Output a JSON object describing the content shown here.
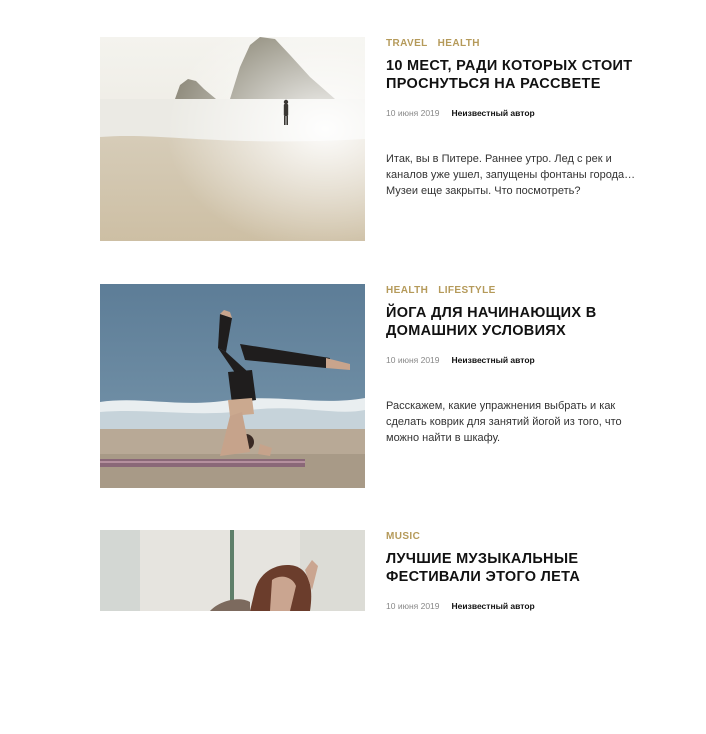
{
  "posts": [
    {
      "categories": [
        "TRAVEL",
        "HEALTH"
      ],
      "title": "10 мест, ради которых стоит проснуться на рассвете",
      "date": "10 июня 2019",
      "author": "Неизвестный автор",
      "excerpt": "Итак, вы в Питере. Раннее утро. Лед с рек и каналов уже ушел, запущены фонтаны города… Музеи еще закрыты. Что посмотреть?"
    },
    {
      "categories": [
        "HEALTH",
        "LIFESTYLE"
      ],
      "title": "Йога для начинающих в домашних условиях",
      "date": "10 июня 2019",
      "author": "Неизвестный автор",
      "excerpt": "Расскажем, какие упражнения выбрать и как сделать коврик для занятий йогой из того, что можно найти в шкафу."
    },
    {
      "categories": [
        "MUSIC"
      ],
      "title": "Лучшие музыкальные фестивали этого лета",
      "date": "10 июня 2019",
      "author": "Неизвестный автор",
      "excerpt": ""
    }
  ],
  "colors": {
    "category": "#b59a5a",
    "title": "#111111",
    "date": "#888888"
  }
}
